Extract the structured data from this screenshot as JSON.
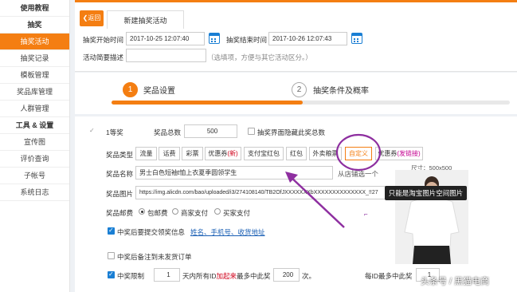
{
  "sidebar": {
    "items": [
      {
        "label": "使用教程",
        "type": "head"
      },
      {
        "label": "抽奖",
        "type": "head"
      },
      {
        "label": "抽奖活动",
        "type": "active"
      },
      {
        "label": "抽奖记录",
        "type": "item"
      },
      {
        "label": "模板管理",
        "type": "item"
      },
      {
        "label": "奖品库管理",
        "type": "item"
      },
      {
        "label": "人群管理",
        "type": "item"
      },
      {
        "label": "工具 & 设置",
        "type": "head"
      },
      {
        "label": "宣传图",
        "type": "item"
      },
      {
        "label": "评价查询",
        "type": "item"
      },
      {
        "label": "子帐号",
        "type": "item"
      },
      {
        "label": "系统日志",
        "type": "item"
      }
    ]
  },
  "topbar": {
    "back_label": "返回",
    "tab_label": "新建抽奖活动",
    "accent": "#f47e12"
  },
  "form": {
    "start_label": "抽奖开始时间",
    "start_value": "2017-10-25 12:07:40",
    "end_label": "抽奖结束时间",
    "end_value": "2017-10-26 12:07:43",
    "desc_label": "活动简要描述",
    "desc_hint": "（选填项，方便与其它活动区分。）"
  },
  "steps": {
    "step1_num": "1",
    "step1_label": "奖品设置",
    "step2_num": "2",
    "step2_label": "抽奖条件及概率",
    "progress": 0.48
  },
  "prize": {
    "level": "1等奖",
    "total_label": "奖品总数",
    "total_value": "500",
    "hide_label": "抽奖界面隐藏此奖总数",
    "type_label": "奖品类型",
    "types": [
      "流量",
      "话费",
      "彩票",
      "优惠券",
      "支付宝红包",
      "红包",
      "外卖粮票",
      "自定义",
      "优惠券"
    ],
    "type_badge_new": "(新)",
    "type_badge_link": "(发链接)",
    "name_label": "奖品名称",
    "name_value": "男士白色短袖t恤上衣夏季圆领学生",
    "store_link": "从店铺选一个",
    "size_label": "尺寸：500x500",
    "image_label": "奖品图片",
    "image_url": "https://img.alicdn.com/bao/uploaded/i3/274108140/TB2OfJXXXXXXXbXXXXXXXXXXXXXX_!!27",
    "tooltip": "只能是淘宝图片空间图片",
    "shipping_label": "奖品邮费",
    "shipping_options": [
      "包邮费",
      "商家支付",
      "买家支付"
    ],
    "submit_check_label": "中奖后要提交领奖信息",
    "submit_fields": "姓名、手机号、收货地址",
    "remark_label": "中奖后备注到未发货订单",
    "limit_label": "中奖限制",
    "limit_value": "1",
    "limit_text1": "天内所有ID",
    "limit_text_red": "加起来",
    "limit_text2": "最多中此奖",
    "limit_max": "200",
    "limit_unit": "次。",
    "per_id_label": "每ID最多中此奖",
    "per_id_value": "1"
  },
  "watermark": "头条号 / 黑猫电商"
}
